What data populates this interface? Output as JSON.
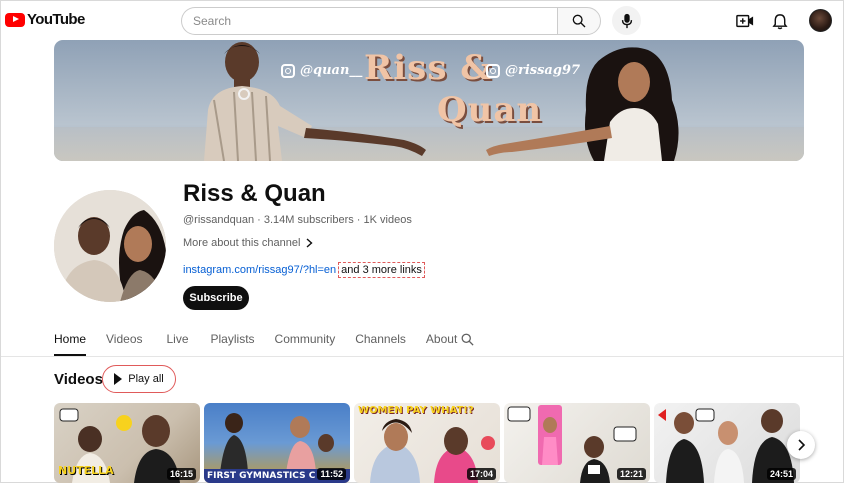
{
  "header": {
    "logo_text": "YouTube",
    "search_placeholder": "Search"
  },
  "banner": {
    "title_line1": "Riss &",
    "title_line2": "Quan",
    "handle_left": "@quan__",
    "handle_right": "@rissag97"
  },
  "channel": {
    "name": "Riss & Quan",
    "meta": "@rissandquan · 3.14M subscribers · 1K videos",
    "more_about": "More about this channel",
    "link": "instagram.com/rissag97/?hl=en",
    "more_links": "and 3 more links",
    "subscribe_label": "Subscribe"
  },
  "tabs": [
    {
      "label": "Home",
      "active": true
    },
    {
      "label": "Videos",
      "active": false
    },
    {
      "label": "Live",
      "active": false
    },
    {
      "label": "Playlists",
      "active": false
    },
    {
      "label": "Community",
      "active": false
    },
    {
      "label": "Channels",
      "active": false
    },
    {
      "label": "About",
      "active": false
    }
  ],
  "videos_section": {
    "title": "Videos",
    "play_all_label": "Play all"
  },
  "videos": [
    {
      "caption": "NUTELLA",
      "duration": "16:15",
      "caption_color": "#f7d21e"
    },
    {
      "caption": "FIRST GYMNASTICS C",
      "duration": "11:52",
      "caption_color": "#ffffff"
    },
    {
      "caption": "WOMEN PAY WHAT!?",
      "duration": "17:04",
      "caption_color": "#f7d21e"
    },
    {
      "caption": "",
      "duration": "12:21",
      "caption_color": "#ffffff"
    },
    {
      "caption": "",
      "duration": "24:51",
      "caption_color": "#ffffff"
    }
  ],
  "colors": {
    "brand_red": "#ff0000",
    "link_blue": "#065fd4",
    "text_primary": "#0f0f0f",
    "text_secondary": "#606060"
  }
}
